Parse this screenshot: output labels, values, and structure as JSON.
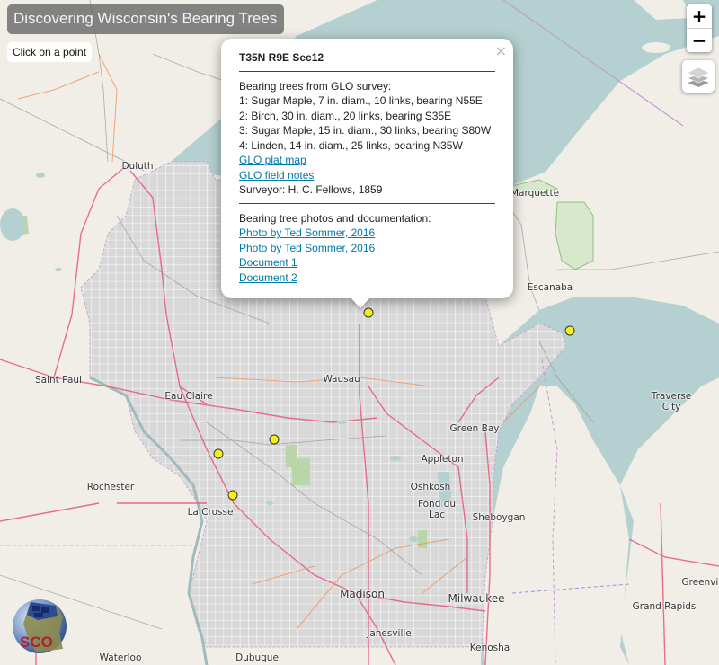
{
  "map": {
    "title": "Discovering Wisconsin's Bearing Trees",
    "hint": "Click on a point",
    "controls": {
      "zoom_in": "+",
      "zoom_out": "−",
      "layers_icon": "layers-icon"
    },
    "colors": {
      "land": "#f1eee8",
      "water": "#b5d0d0",
      "plss_grid_fill": "#d6d6d6",
      "plss_grid_lines": "#ffffff",
      "highway": "#e8577a",
      "road_orange": "#f0925c",
      "road_gray": "#8e8e8e",
      "forest": "#a7cf95",
      "border": "#c49ad4",
      "marker_fill": "#f6f01a",
      "link": "#0078a8"
    },
    "city_labels": [
      {
        "name": "Duluth"
      },
      {
        "name": "Saint Paul"
      },
      {
        "name": "Eau Claire"
      },
      {
        "name": "Wausau"
      },
      {
        "name": "Green Bay"
      },
      {
        "name": "Appleton"
      },
      {
        "name": "Oshkosh"
      },
      {
        "name": "Fond du Lac"
      },
      {
        "name": "Sheboygan"
      },
      {
        "name": "Rochester"
      },
      {
        "name": "La Crosse"
      },
      {
        "name": "Madison"
      },
      {
        "name": "Milwaukee"
      },
      {
        "name": "Janesville"
      },
      {
        "name": "Kenosha"
      },
      {
        "name": "Waterloo"
      },
      {
        "name": "Dubuque"
      },
      {
        "name": "Escanaba"
      },
      {
        "name": "Marquette"
      },
      {
        "name": "Traverse City"
      },
      {
        "name": "Grand Rapids"
      },
      {
        "name": "Greenville"
      }
    ],
    "markers": [
      {
        "id": "selected",
        "label": "T35N R9E Sec12"
      },
      {
        "id": "door-county"
      },
      {
        "id": "central-1"
      },
      {
        "id": "central-2"
      },
      {
        "id": "la-crosse-area"
      }
    ],
    "logo": {
      "text": "SCO"
    }
  },
  "popup": {
    "title": "T35N R9E Sec12",
    "close": "×",
    "survey_heading": "Bearing trees from GLO survey:",
    "trees": [
      "1: Sugar Maple, 7 in. diam., 10 links, bearing N55E",
      "2: Birch, 30 in. diam., 20 links, bearing S35E",
      "3: Sugar Maple, 15 in. diam., 30 links, bearing S80W",
      "4: Linden, 14 in. diam., 25 links, bearing N35W"
    ],
    "links_glo": [
      "GLO plat map",
      "GLO field notes"
    ],
    "surveyor": "Surveyor: H. C. Fellows, 1859",
    "photos_heading": "Bearing tree photos and documentation:",
    "links_docs": [
      "Photo by Ted Sommer, 2016",
      "Photo by Ted Sommer, 2016",
      "Document 1",
      "Document 2"
    ]
  }
}
